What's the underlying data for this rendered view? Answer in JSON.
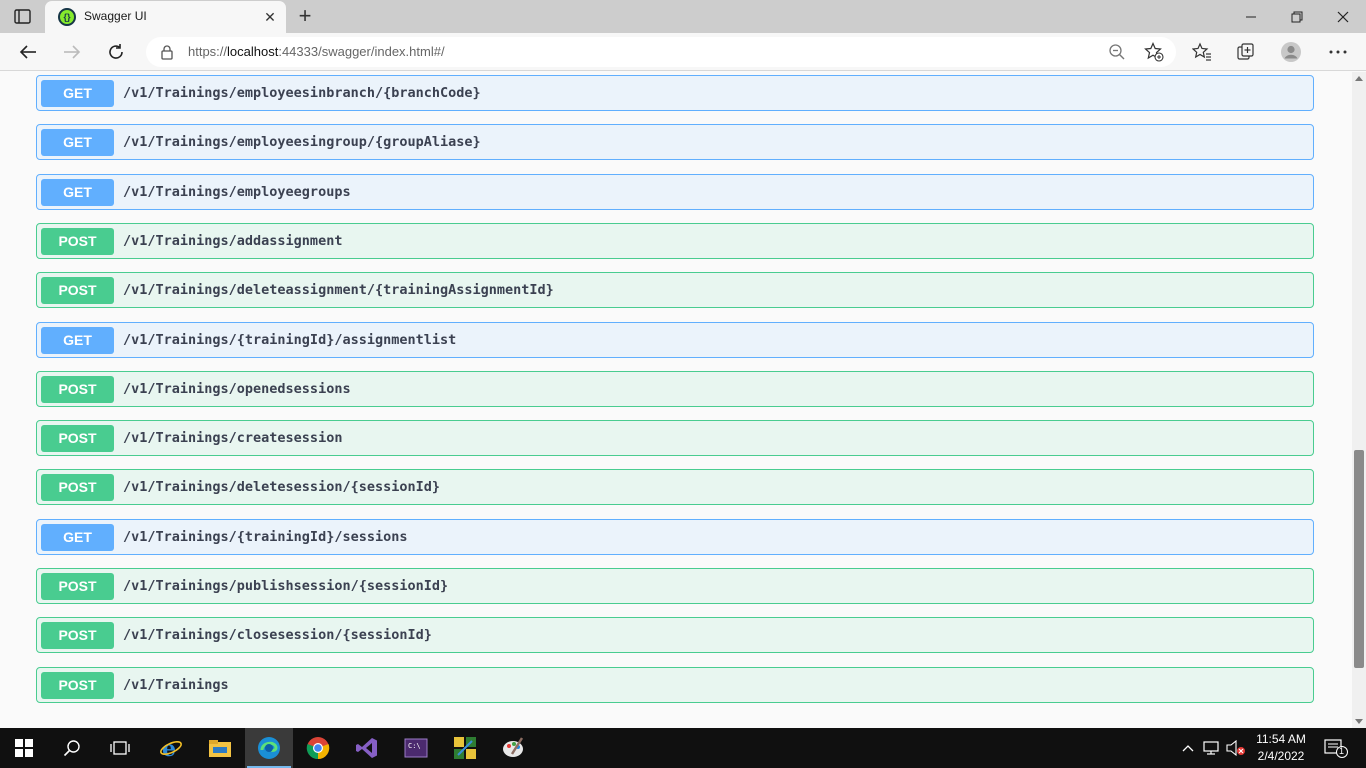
{
  "browser": {
    "tab_title": "Swagger UI",
    "url_prefix": "https://",
    "url_host": "localhost",
    "url_rest": ":44333/swagger/index.html#/"
  },
  "operations": [
    {
      "method": "GET",
      "path": "/v1/Trainings/employeesinbranch/{branchCode}"
    },
    {
      "method": "GET",
      "path": "/v1/Trainings/employeesingroup/{groupAliase}"
    },
    {
      "method": "GET",
      "path": "/v1/Trainings/employeegroups"
    },
    {
      "method": "POST",
      "path": "/v1/Trainings/addassignment"
    },
    {
      "method": "POST",
      "path": "/v1/Trainings/deleteassignment/{trainingAssignmentId}"
    },
    {
      "method": "GET",
      "path": "/v1/Trainings/{trainingId}/assignmentlist"
    },
    {
      "method": "POST",
      "path": "/v1/Trainings/openedsessions"
    },
    {
      "method": "POST",
      "path": "/v1/Trainings/createsession"
    },
    {
      "method": "POST",
      "path": "/v1/Trainings/deletesession/{sessionId}"
    },
    {
      "method": "GET",
      "path": "/v1/Trainings/{trainingId}/sessions"
    },
    {
      "method": "POST",
      "path": "/v1/Trainings/publishsession/{sessionId}"
    },
    {
      "method": "POST",
      "path": "/v1/Trainings/closesession/{sessionId}"
    },
    {
      "method": "POST",
      "path": "/v1/Trainings"
    }
  ],
  "colors": {
    "get": "#61affe",
    "post": "#49cc90"
  },
  "taskbar": {
    "time": "11:54 AM",
    "date": "2/4/2022",
    "notification_count": "1"
  }
}
